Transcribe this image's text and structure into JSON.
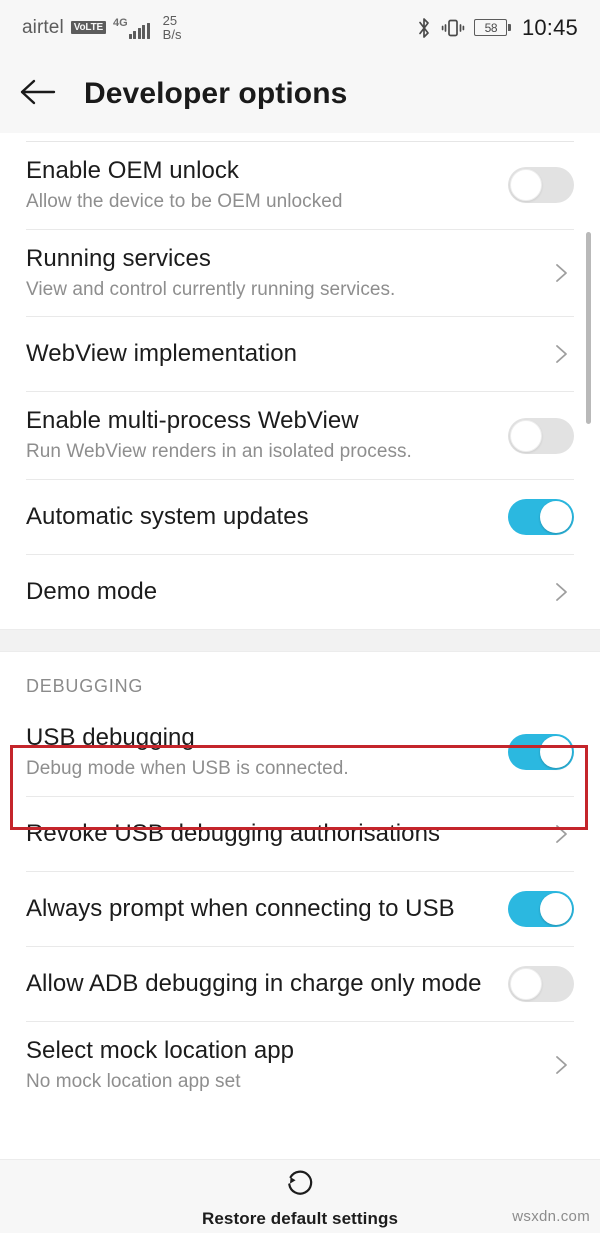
{
  "status_bar": {
    "carrier": "airtel",
    "volte_badge": "VoLTE",
    "network_type": "4G",
    "net_speed_value": "25",
    "net_speed_unit": "B/s",
    "battery_percent": "58",
    "clock": "10:45",
    "icons": [
      "bluetooth-icon",
      "vibrate-icon",
      "battery-icon"
    ]
  },
  "app_bar": {
    "back_label": "back-arrow",
    "title": "Developer options"
  },
  "colors": {
    "toggle_on": "#2BB8E0",
    "toggle_off": "#e2e2e2",
    "highlight_border": "#C4252B",
    "chrome_bg": "#f7f7f7",
    "divider": "#e9e9e9"
  },
  "sections": [
    {
      "header": null,
      "rows": [
        {
          "title": "Enable OEM unlock",
          "subtitle": "Allow the device to be OEM unlocked",
          "control": "toggle",
          "state": "off"
        },
        {
          "title": "Running services",
          "subtitle": "View and control currently running services.",
          "control": "chevron",
          "state": null
        },
        {
          "title": "WebView implementation",
          "subtitle": null,
          "control": "chevron",
          "state": null
        },
        {
          "title": "Enable multi-process WebView",
          "subtitle": "Run WebView renders in an isolated process.",
          "control": "toggle",
          "state": "off"
        },
        {
          "title": "Automatic system updates",
          "subtitle": null,
          "control": "toggle",
          "state": "on"
        },
        {
          "title": "Demo mode",
          "subtitle": null,
          "control": "chevron",
          "state": null
        }
      ]
    },
    {
      "header": "DEBUGGING",
      "rows": [
        {
          "title": "USB debugging",
          "subtitle": "Debug mode when USB is connected.",
          "control": "toggle",
          "state": "on",
          "highlighted": true
        },
        {
          "title": "Revoke USB debugging authorisations",
          "subtitle": null,
          "control": "chevron",
          "state": null
        },
        {
          "title": "Always prompt when connecting to USB",
          "subtitle": null,
          "control": "toggle",
          "state": "on"
        },
        {
          "title": "Allow ADB debugging in charge only mode",
          "subtitle": null,
          "control": "toggle",
          "state": "off"
        },
        {
          "title": "Select mock location app",
          "subtitle": "No mock location app set",
          "control": "chevron",
          "state": null
        }
      ]
    }
  ],
  "bottom_bar": {
    "restore_label": "Restore default settings",
    "restore_icon": "restore-circular-arrow-icon"
  },
  "watermark": "wsxdn.com"
}
